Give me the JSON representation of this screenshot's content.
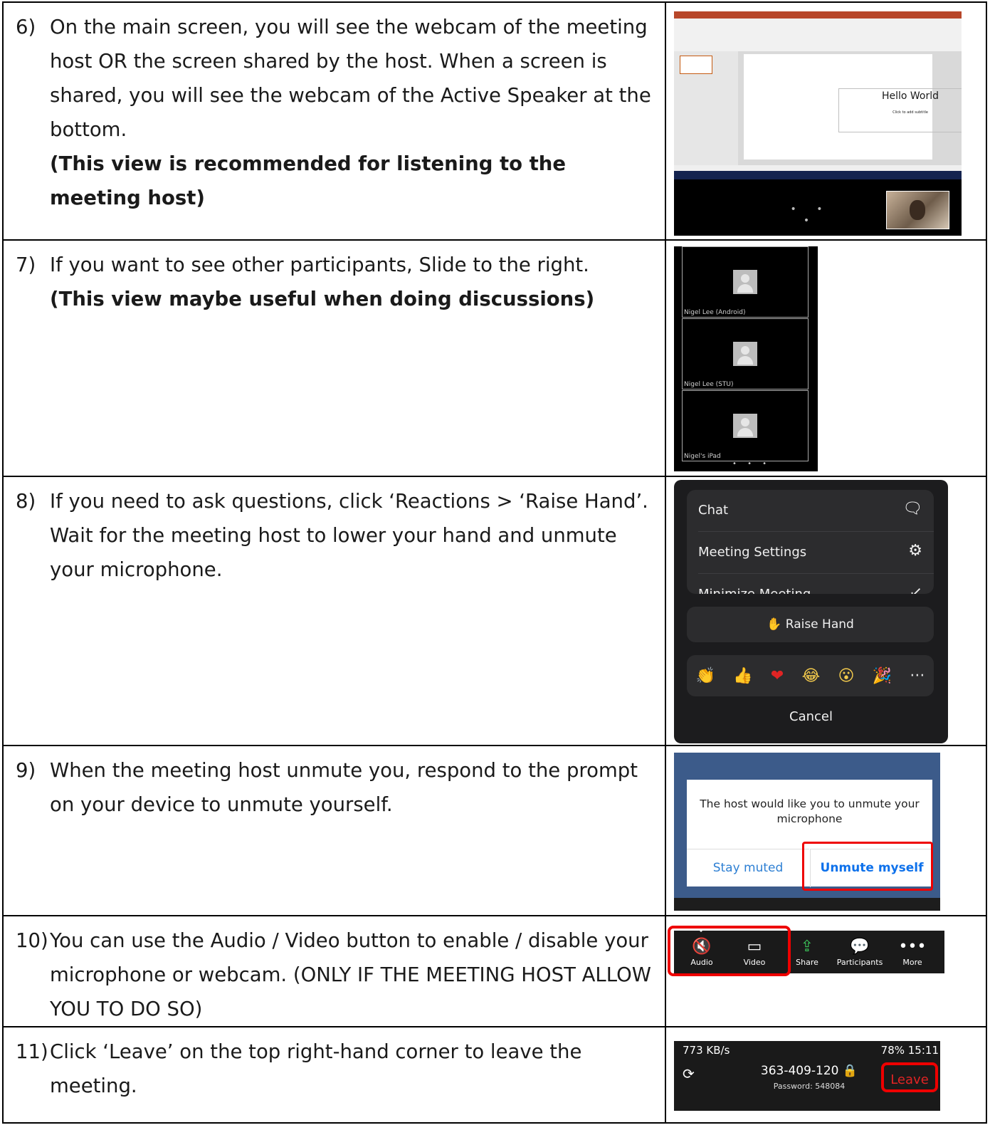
{
  "steps": [
    {
      "num": "6)",
      "text": "On the main screen, you will see the webcam of the meeting host OR the screen shared by the host. When a screen is shared, you will see the webcam of the Active Speaker at the bottom.",
      "bold": "(This view is recommended for listening to the meeting host)"
    },
    {
      "num": "7)",
      "text": "If you want to see other participants, Slide to the right.",
      "bold": "(This view maybe useful when doing discussions)"
    },
    {
      "num": "8)",
      "text": "If you need to ask questions, click ‘Reactions > ‘Raise Hand’. Wait for the meeting host to lower your hand and unmute your microphone.",
      "bold": ""
    },
    {
      "num": "9)",
      "text": "When the meeting host unmute you, respond to the prompt on your device to unmute yourself.",
      "bold": ""
    },
    {
      "num": "10)",
      "text": "You can use the Audio / Video button to enable / disable your microphone or webcam. (ONLY IF THE MEETING HOST ALLOW YOU TO DO SO)",
      "bold": ""
    },
    {
      "num": "11)",
      "text": "Click ‘Leave’ on the top right-hand corner to leave the meeting.",
      "bold": ""
    }
  ],
  "shot_ppt": {
    "slide_title": "Hello World",
    "slide_subtitle": "Click to add subtitle",
    "dots": "• • •"
  },
  "shot_participants": {
    "tiles": [
      "Nigel Lee (Android)",
      "Nigel Lee (STU)",
      "Nigel's iPad"
    ],
    "dots": "• • •"
  },
  "shot_menu": {
    "chat": "Chat",
    "settings": "Meeting Settings",
    "minimize": "Minimize Meeting",
    "raise_hand": "Raise Hand",
    "emojis": [
      "👏",
      "👍",
      "❤",
      "😂",
      "😮",
      "🎉",
      "···"
    ],
    "cancel": "Cancel"
  },
  "shot_unmute": {
    "message": "The host would like you to unmute your microphone",
    "stay": "Stay muted",
    "unmute": "Unmute myself"
  },
  "shot_toolbar": {
    "audio": "Audio",
    "video": "Video",
    "share": "Share",
    "participants": "Participants",
    "more": "More"
  },
  "shot_leave": {
    "status_left": "773 KB/s",
    "status_right": "78% 15:11",
    "meeting_id": "363-409-120",
    "password": "Password: 548084",
    "leave": "Leave"
  },
  "colors": {
    "highlight": "#e00000",
    "zoom_blue": "#0e71eb"
  }
}
